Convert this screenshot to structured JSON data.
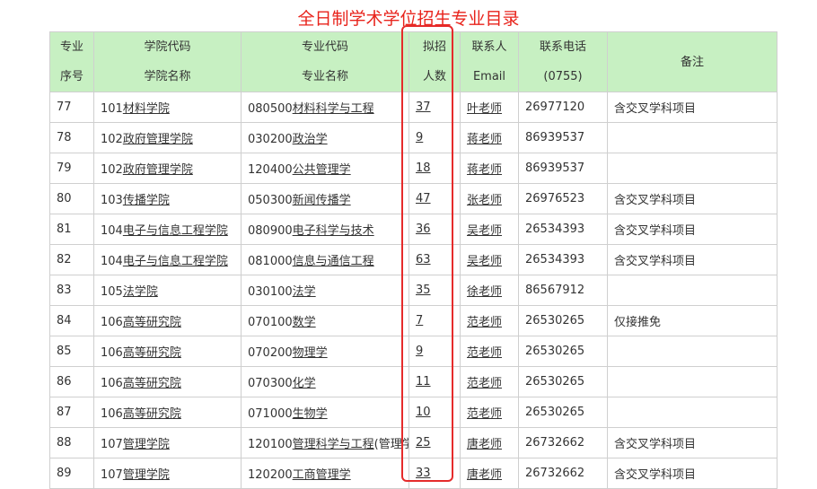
{
  "page_title": "全日制学术学位招生专业目录",
  "headers": {
    "seq": [
      "专业",
      "序号"
    ],
    "college": [
      "学院代码",
      "学院名称"
    ],
    "major": [
      "专业代码",
      "专业名称"
    ],
    "plan": [
      "拟招",
      "人数"
    ],
    "contact": [
      "联系人",
      "Email"
    ],
    "phone": [
      "联系电话",
      "(0755)"
    ],
    "note": "备注"
  },
  "rows": [
    {
      "seq": "77",
      "college_code": "101",
      "college_name": "材料学院",
      "major_code": "080500",
      "major_name": "材料科学与工程",
      "major_suffix": "",
      "plan": "37",
      "contact": "叶老师",
      "phone": "26977120",
      "note": "含交叉学科项目"
    },
    {
      "seq": "78",
      "college_code": "102",
      "college_name": "政府管理学院",
      "major_code": "030200",
      "major_name": "政治学",
      "major_suffix": "",
      "plan": "9",
      "contact": "蒋老师",
      "phone": "86939537",
      "note": ""
    },
    {
      "seq": "79",
      "college_code": "102",
      "college_name": "政府管理学院",
      "major_code": "120400",
      "major_name": "公共管理学",
      "major_suffix": "",
      "plan": "18",
      "contact": "蒋老师",
      "phone": "86939537",
      "note": ""
    },
    {
      "seq": "80",
      "college_code": "103",
      "college_name": "传播学院",
      "major_code": "050300",
      "major_name": "新闻传播学",
      "major_suffix": "",
      "plan": "47",
      "contact": "张老师",
      "phone": "26976523",
      "note": "含交叉学科项目"
    },
    {
      "seq": "81",
      "college_code": "104",
      "college_name": "电子与信息工程学院",
      "major_code": "080900",
      "major_name": "电子科学与技术",
      "major_suffix": "",
      "plan": "36",
      "contact": "吴老师",
      "phone": "26534393",
      "note": "含交叉学科项目"
    },
    {
      "seq": "82",
      "college_code": "104",
      "college_name": "电子与信息工程学院",
      "major_code": "081000",
      "major_name": "信息与通信工程",
      "major_suffix": "",
      "plan": "63",
      "contact": "吴老师",
      "phone": "26534393",
      "note": "含交叉学科项目"
    },
    {
      "seq": "83",
      "college_code": "105",
      "college_name": "法学院",
      "major_code": "030100",
      "major_name": "法学",
      "major_suffix": "",
      "plan": "35",
      "contact": "徐老师",
      "phone": "86567912",
      "note": ""
    },
    {
      "seq": "84",
      "college_code": "106",
      "college_name": "高等研究院",
      "major_code": "070100",
      "major_name": "数学",
      "major_suffix": "",
      "plan": "7",
      "contact": "范老师",
      "phone": "26530265",
      "note": "仅接推免"
    },
    {
      "seq": "85",
      "college_code": "106",
      "college_name": "高等研究院",
      "major_code": "070200",
      "major_name": "物理学",
      "major_suffix": "",
      "plan": "9",
      "contact": "范老师",
      "phone": "26530265",
      "note": ""
    },
    {
      "seq": "86",
      "college_code": "106",
      "college_name": "高等研究院",
      "major_code": "070300",
      "major_name": "化学",
      "major_suffix": "",
      "plan": "11",
      "contact": "范老师",
      "phone": "26530265",
      "note": ""
    },
    {
      "seq": "87",
      "college_code": "106",
      "college_name": "高等研究院",
      "major_code": "071000",
      "major_name": "生物学",
      "major_suffix": "",
      "plan": "10",
      "contact": "范老师",
      "phone": "26530265",
      "note": ""
    },
    {
      "seq": "88",
      "college_code": "107",
      "college_name": "管理学院",
      "major_code": "120100",
      "major_name": "管理科学与工程",
      "major_suffix": "(管理学)",
      "plan": "25",
      "contact": "唐老师",
      "phone": "26732662",
      "note": "含交叉学科项目"
    },
    {
      "seq": "89",
      "college_code": "107",
      "college_name": "管理学院",
      "major_code": "120200",
      "major_name": "工商管理学",
      "major_suffix": "",
      "plan": "33",
      "contact": "唐老师",
      "phone": "26732662",
      "note": "含交叉学科项目"
    }
  ],
  "colors": {
    "title": "#e8231b",
    "header_bg": "#c7f0c2",
    "highlight_border": "#e52b2b",
    "grid": "#cfcfcf"
  }
}
